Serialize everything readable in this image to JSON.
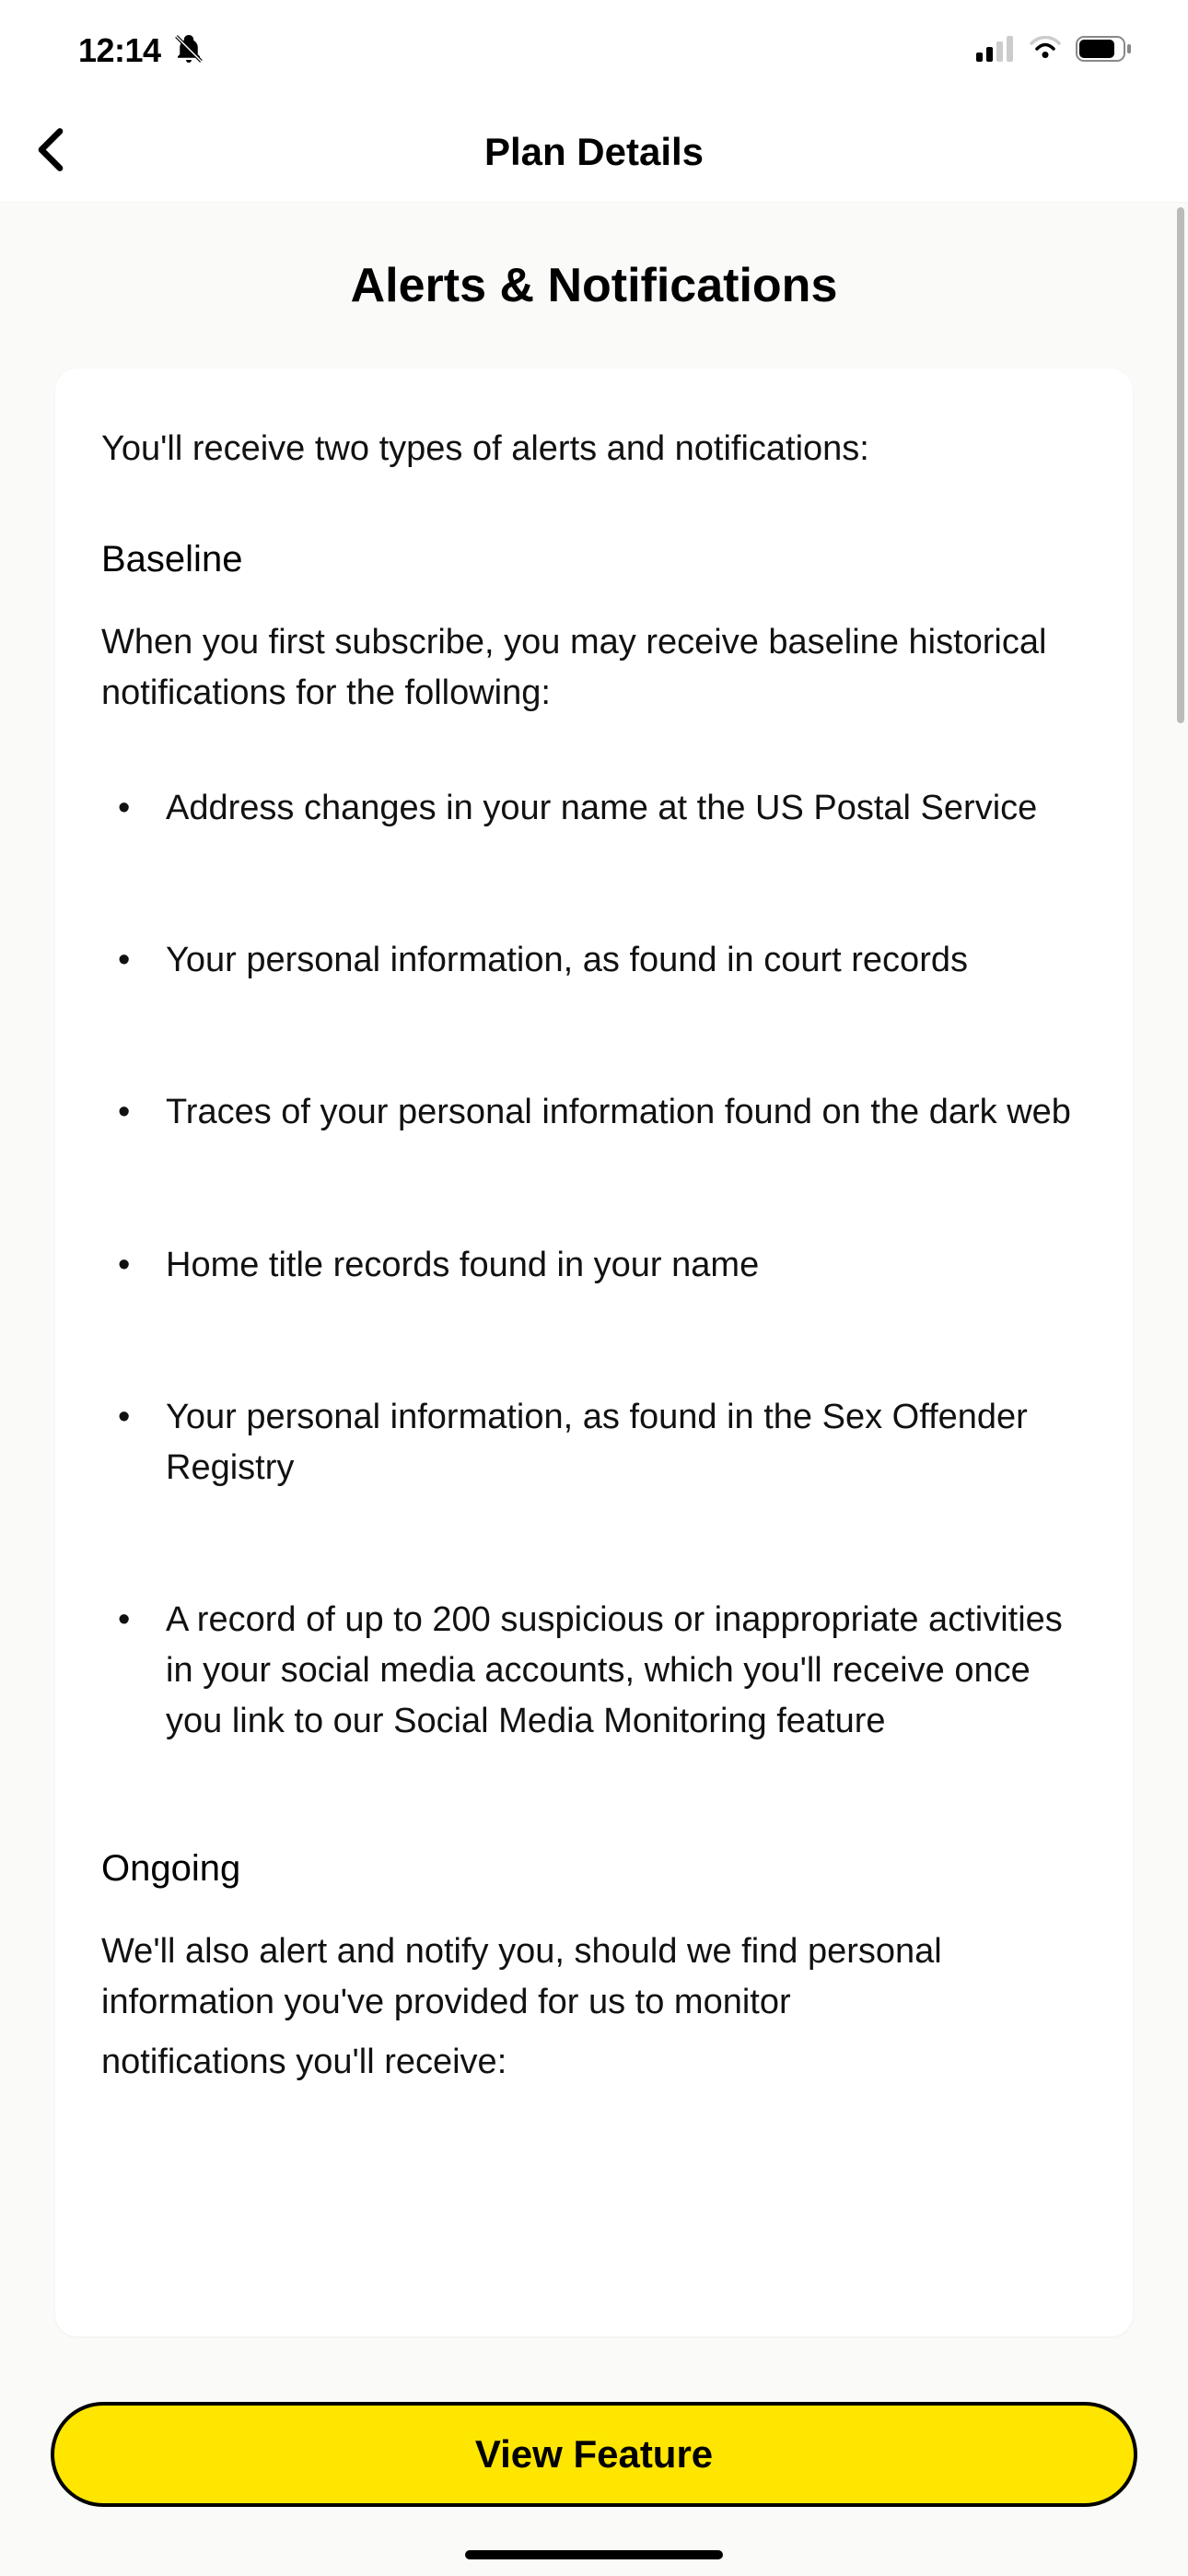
{
  "status_bar": {
    "time": "12:14"
  },
  "nav": {
    "title": "Plan Details"
  },
  "content": {
    "section_title": "Alerts & Notifications",
    "intro": "You'll receive two types of alerts and notifications:",
    "baseline": {
      "heading": "Baseline",
      "description": "When you first subscribe, you may receive baseline historical notifications for the following:",
      "items": [
        "Address changes in your name at the US Postal Service",
        "Your personal information, as found in court records",
        "Traces of your personal information found on the dark web",
        "Home title records found in your name",
        "Your personal information, as found in the Sex Offender Registry",
        "A record of up to 200 suspicious or inappropriate activities in your social media accounts, which you'll receive once you link to our Social Media Monitoring feature"
      ]
    },
    "ongoing": {
      "heading": "Ongoing",
      "description_partial": "We'll also alert and notify you, should we find personal information you've provided for us to monitor",
      "trailing_partial": "notifications you'll receive:"
    }
  },
  "cta": {
    "label": "View Feature"
  },
  "colors": {
    "background": "#fafaf9",
    "card": "#ffffff",
    "cta_bg": "#ffe600",
    "cta_border": "#000000"
  }
}
